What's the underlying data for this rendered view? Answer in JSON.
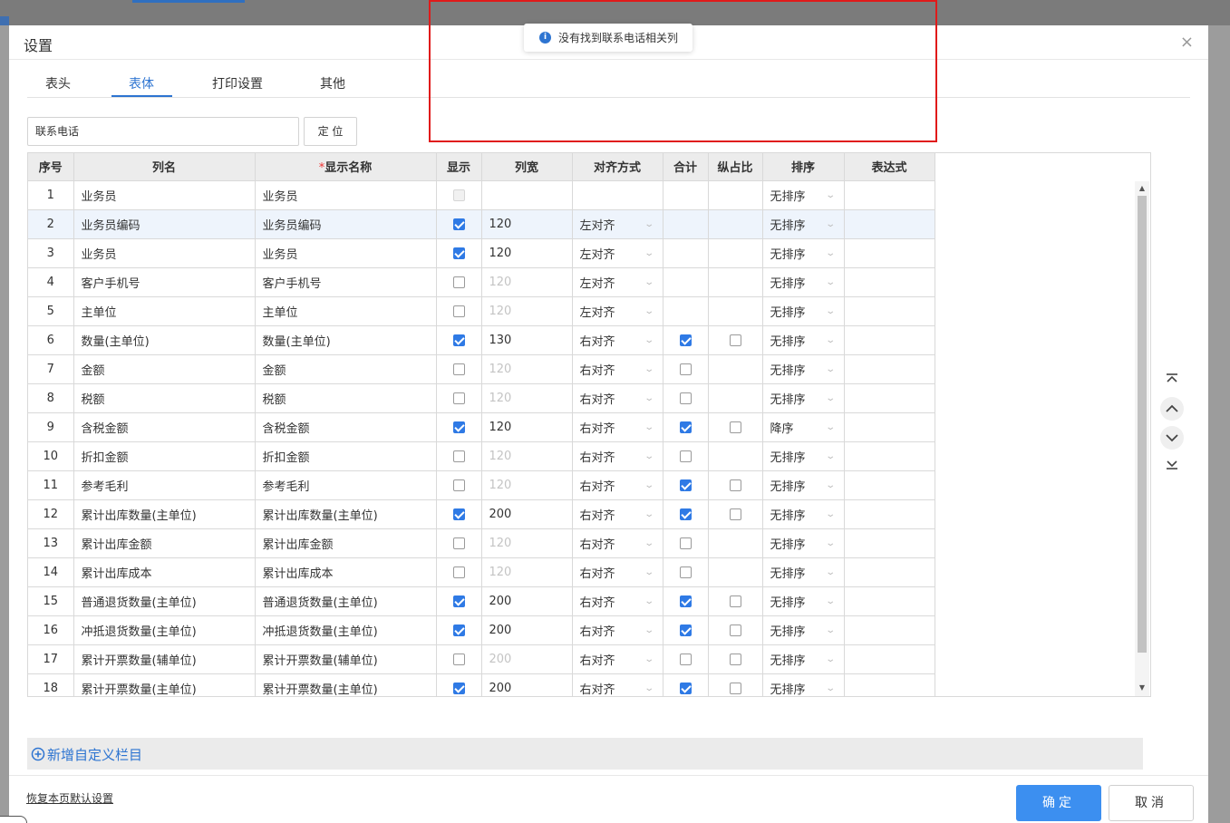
{
  "dialog": {
    "title": "设置",
    "close": "×",
    "tabs": [
      "表头",
      "表体",
      "打印设置",
      "其他"
    ],
    "active_tab": "表体"
  },
  "search": {
    "value": "联系电话"
  },
  "locate_button": "定 位",
  "toast": {
    "message": "没有找到联系电话相关列",
    "icon": "info-icon"
  },
  "table": {
    "headers": {
      "no": "序号",
      "col_name": "列名",
      "required_mark": "*",
      "display_name": "显示名称",
      "show": "显示",
      "width": "列宽",
      "align": "对齐方式",
      "sum": "合计",
      "ratio": "纵占比",
      "sort": "排序",
      "expr": "表达式"
    },
    "rows": [
      {
        "no": "1",
        "name": "业务员",
        "disp": "业务员",
        "show": "disabled",
        "width": "",
        "align": "",
        "sum": "none",
        "ratio": "none",
        "sort": "无排序",
        "indent": false
      },
      {
        "no": "2",
        "name": "业务员编码",
        "disp": "业务员编码",
        "show": "on",
        "width": "120",
        "align": "左对齐",
        "sum": "none",
        "ratio": "none",
        "sort": "无排序",
        "indent": true,
        "highlight": true
      },
      {
        "no": "3",
        "name": "业务员",
        "disp": "业务员",
        "show": "on",
        "width": "120",
        "align": "左对齐",
        "sum": "none",
        "ratio": "none",
        "sort": "无排序",
        "indent": true
      },
      {
        "no": "4",
        "name": "客户手机号",
        "disp": "客户手机号",
        "show": "off",
        "width": "120",
        "align": "左对齐",
        "sum": "none",
        "ratio": "none",
        "sort": "无排序",
        "indent": false
      },
      {
        "no": "5",
        "name": "主单位",
        "disp": "主单位",
        "show": "off",
        "width": "120",
        "align": "左对齐",
        "sum": "none",
        "ratio": "none",
        "sort": "无排序",
        "indent": false
      },
      {
        "no": "6",
        "name": "数量(主单位)",
        "disp": "数量(主单位)",
        "show": "on",
        "width": "130",
        "align": "右对齐",
        "sum": "on",
        "ratio": "off",
        "sort": "无排序",
        "indent": false
      },
      {
        "no": "7",
        "name": "金额",
        "disp": "金额",
        "show": "off",
        "width": "120",
        "align": "右对齐",
        "sum": "off",
        "ratio": "none",
        "sort": "无排序",
        "indent": false
      },
      {
        "no": "8",
        "name": "税额",
        "disp": "税额",
        "show": "off",
        "width": "120",
        "align": "右对齐",
        "sum": "off",
        "ratio": "none",
        "sort": "无排序",
        "indent": false
      },
      {
        "no": "9",
        "name": "含税金额",
        "disp": "含税金额",
        "show": "on",
        "width": "120",
        "align": "右对齐",
        "sum": "on",
        "ratio": "off",
        "sort": "降序",
        "indent": false
      },
      {
        "no": "10",
        "name": "折扣金额",
        "disp": "折扣金额",
        "show": "off",
        "width": "120",
        "align": "右对齐",
        "sum": "off",
        "ratio": "none",
        "sort": "无排序",
        "indent": false
      },
      {
        "no": "11",
        "name": "参考毛利",
        "disp": "参考毛利",
        "show": "off",
        "width": "120",
        "align": "右对齐",
        "sum": "on",
        "ratio": "off",
        "sort": "无排序",
        "indent": false
      },
      {
        "no": "12",
        "name": "累计出库数量(主单位)",
        "disp": "累计出库数量(主单位)",
        "show": "on",
        "width": "200",
        "align": "右对齐",
        "sum": "on",
        "ratio": "off",
        "sort": "无排序",
        "indent": false
      },
      {
        "no": "13",
        "name": "累计出库金额",
        "disp": "累计出库金额",
        "show": "off",
        "width": "120",
        "align": "右对齐",
        "sum": "off",
        "ratio": "none",
        "sort": "无排序",
        "indent": false
      },
      {
        "no": "14",
        "name": "累计出库成本",
        "disp": "累计出库成本",
        "show": "off",
        "width": "120",
        "align": "右对齐",
        "sum": "off",
        "ratio": "none",
        "sort": "无排序",
        "indent": false
      },
      {
        "no": "15",
        "name": "普通退货数量(主单位)",
        "disp": "普通退货数量(主单位)",
        "show": "on",
        "width": "200",
        "align": "右对齐",
        "sum": "on",
        "ratio": "off",
        "sort": "无排序",
        "indent": false
      },
      {
        "no": "16",
        "name": "冲抵退货数量(主单位)",
        "disp": "冲抵退货数量(主单位)",
        "show": "on",
        "width": "200",
        "align": "右对齐",
        "sum": "on",
        "ratio": "off",
        "sort": "无排序",
        "indent": false
      },
      {
        "no": "17",
        "name": "累计开票数量(辅单位)",
        "disp": "累计开票数量(辅单位)",
        "show": "off",
        "width": "200",
        "align": "右对齐",
        "sum": "off",
        "ratio": "off",
        "sort": "无排序",
        "indent": false
      },
      {
        "no": "18",
        "name": "累计开票数量(主单位)",
        "disp": "累计开票数量(主单位)",
        "show": "on",
        "width": "200",
        "align": "右对齐",
        "sum": "on",
        "ratio": "off",
        "sort": "无排序",
        "indent": false
      }
    ]
  },
  "move_controls": {
    "top": "move-to-top-icon",
    "up": "move-up-icon",
    "down": "move-down-icon",
    "bottom": "move-to-bottom-icon"
  },
  "add_custom": {
    "label": "新增自定义栏目",
    "icon": "plus-circle-icon"
  },
  "footer": {
    "restore": "恢复本页默认设置",
    "ok": "确定",
    "cancel": "取消"
  },
  "colors": {
    "accent": "#2d74d1",
    "primary_button": "#3c8ff0",
    "highlight_frame": "#e01a1a"
  }
}
